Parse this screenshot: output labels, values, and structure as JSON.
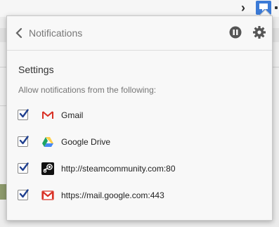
{
  "popup": {
    "header": {
      "title": "Notifications"
    },
    "settings": {
      "heading": "Settings",
      "subtitle": "Allow notifications from the following:"
    },
    "sources": [
      {
        "label": "Gmail",
        "checked": true,
        "icon": "gmail-icon"
      },
      {
        "label": "Google Drive",
        "checked": true,
        "icon": "google-drive-icon"
      },
      {
        "label": "http://steamcommunity.com:80",
        "checked": true,
        "icon": "steam-icon"
      },
      {
        "label": "https://mail.google.com:443",
        "checked": true,
        "icon": "gmail-red-icon"
      }
    ]
  },
  "colors": {
    "accent": "#3b7ad6",
    "checkbox_mark": "#1f3f8f",
    "gmail_red": "#d93025",
    "drive_green": "#1fa463",
    "drive_yellow": "#ffd04b",
    "drive_blue": "#4688f4"
  }
}
